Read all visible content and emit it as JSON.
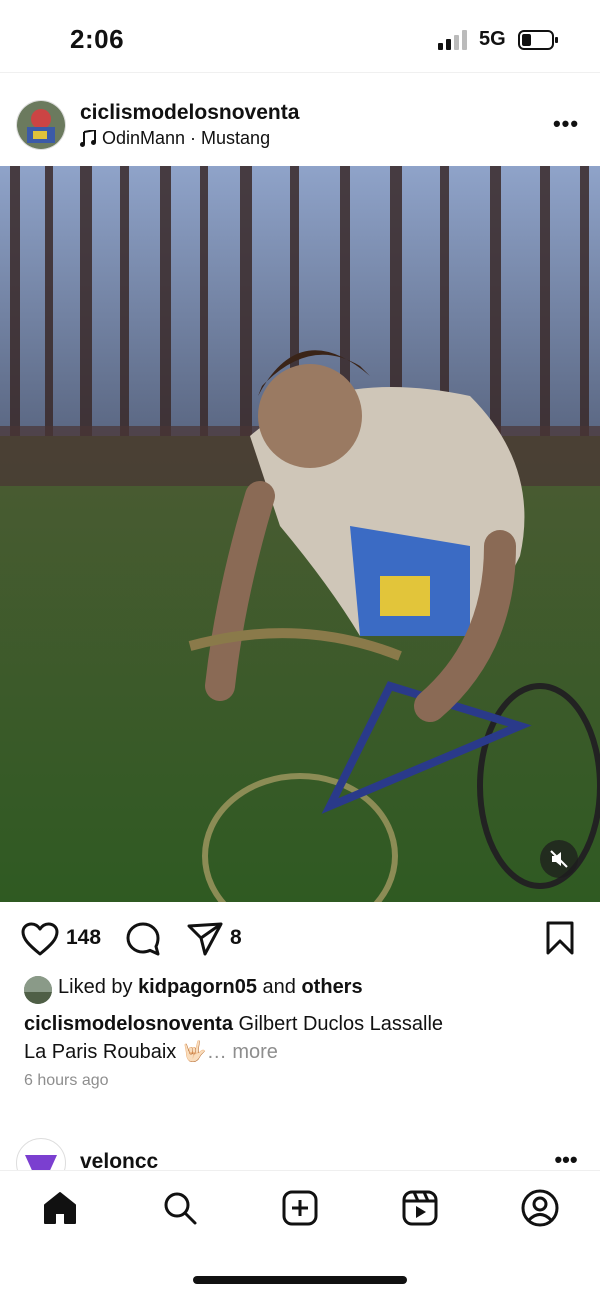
{
  "status_bar": {
    "time": "2:06",
    "network": "5G"
  },
  "post": {
    "username": "ciclismodelosnoventa",
    "music": "OdinMann · Mustang",
    "likes": "148",
    "shares": "8",
    "liked_by_prefix": "Liked by ",
    "liked_by_user": "kidpagorn05",
    "liked_by_and": " and ",
    "liked_by_others": "others",
    "caption_user": "ciclismodelosnoventa",
    "caption_text_line1": " Gilbert  Duclos Lassalle",
    "caption_text_line2": "La Paris Roubaix 🤟🏻",
    "caption_more": "… more",
    "time_ago": "6 hours ago"
  },
  "next_post": {
    "username": "veloncc"
  },
  "icons": {
    "like": "heart-icon",
    "comment": "comment-icon",
    "share": "send-icon",
    "save": "bookmark-icon",
    "mute": "speaker-muted-icon",
    "music": "music-note-icon"
  },
  "tabs": [
    "home",
    "search",
    "create",
    "reels",
    "profile"
  ]
}
